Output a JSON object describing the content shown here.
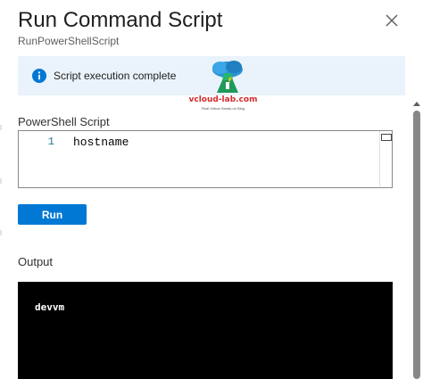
{
  "panel": {
    "title": "Run Command Script",
    "subtitle": "RunPowerShellScript"
  },
  "banner": {
    "message": "Script execution complete",
    "icon": "info-icon",
    "color": "#0078d4",
    "background": "#eaf3fb"
  },
  "watermark": {
    "name": "vcloud-lab.com",
    "tagline": "Real Virtual Hands-on Blog"
  },
  "script_section": {
    "label": "PowerShell Script",
    "lines": [
      {
        "number": "1",
        "code": "hostname"
      }
    ]
  },
  "actions": {
    "run_label": "Run",
    "run_color": "#0078d4"
  },
  "output_section": {
    "label": "Output",
    "text": "devvm",
    "background": "#000000"
  }
}
